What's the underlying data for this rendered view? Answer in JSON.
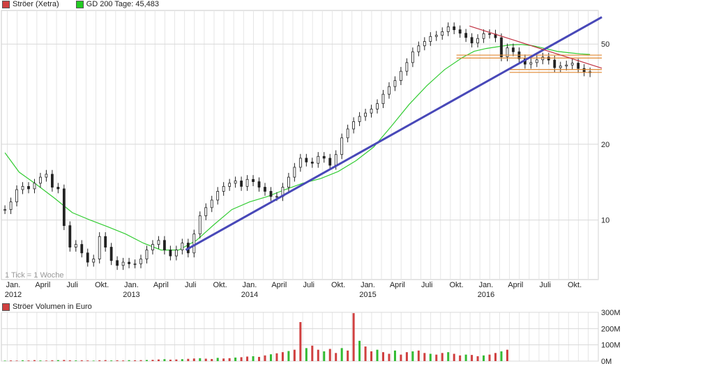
{
  "legend_main": [
    {
      "label": "Ströer (Xetra)",
      "color": "#d04040"
    },
    {
      "label": "GD 200 Tage: 45,483",
      "color": "#22cc22"
    }
  ],
  "legend_volume": {
    "label": "Ströer Volumen in Euro",
    "color": "#d04040"
  },
  "tick_note": "1 Tick = 1 Woche",
  "chart_data": [
    {
      "type": "line",
      "title": "Ströer (Xetra)",
      "yscale": "log",
      "ylim": [
        5.8,
        68
      ],
      "y_ticks": [
        10,
        20,
        50
      ],
      "x_tick_labels": [
        {
          "label": "Jan.",
          "year": "2012",
          "x": 2012.0
        },
        {
          "label": "April",
          "x": 2012.25
        },
        {
          "label": "Juli",
          "x": 2012.5
        },
        {
          "label": "Okt.",
          "x": 2012.75
        },
        {
          "label": "Jan.",
          "year": "2013",
          "x": 2013.0
        },
        {
          "label": "April",
          "x": 2013.25
        },
        {
          "label": "Juli",
          "x": 2013.5
        },
        {
          "label": "Okt.",
          "x": 2013.75
        },
        {
          "label": "Jan.",
          "year": "2014",
          "x": 2014.0
        },
        {
          "label": "April",
          "x": 2014.25
        },
        {
          "label": "Juli",
          "x": 2014.5
        },
        {
          "label": "Okt.",
          "x": 2014.75
        },
        {
          "label": "Jan.",
          "year": "2015",
          "x": 2015.0
        },
        {
          "label": "April",
          "x": 2015.25
        },
        {
          "label": "Juli",
          "x": 2015.5
        },
        {
          "label": "Okt.",
          "x": 2015.75
        },
        {
          "label": "Jan.",
          "year": "2016",
          "x": 2016.0
        },
        {
          "label": "April",
          "x": 2016.25
        },
        {
          "label": "Juli",
          "x": 2016.5
        },
        {
          "label": "Okt.",
          "x": 2016.75
        }
      ],
      "price_series": {
        "name": "Ströer (Xetra)",
        "x": [
          2011.93,
          2011.98,
          2012.03,
          2012.08,
          2012.13,
          2012.18,
          2012.23,
          2012.28,
          2012.33,
          2012.38,
          2012.43,
          2012.48,
          2012.53,
          2012.58,
          2012.63,
          2012.68,
          2012.73,
          2012.78,
          2012.83,
          2012.88,
          2012.93,
          2012.98,
          2013.03,
          2013.08,
          2013.13,
          2013.18,
          2013.23,
          2013.28,
          2013.33,
          2013.38,
          2013.43,
          2013.48,
          2013.53,
          2013.58,
          2013.63,
          2013.68,
          2013.73,
          2013.78,
          2013.83,
          2013.88,
          2013.93,
          2013.98,
          2014.03,
          2014.08,
          2014.13,
          2014.18,
          2014.23,
          2014.28,
          2014.33,
          2014.38,
          2014.43,
          2014.48,
          2014.53,
          2014.58,
          2014.63,
          2014.68,
          2014.73,
          2014.78,
          2014.83,
          2014.88,
          2014.93,
          2014.98,
          2015.03,
          2015.08,
          2015.13,
          2015.18,
          2015.23,
          2015.28,
          2015.33,
          2015.38,
          2015.43,
          2015.48,
          2015.53,
          2015.58,
          2015.63,
          2015.68,
          2015.73,
          2015.78,
          2015.83,
          2015.88,
          2015.93,
          2015.98,
          2016.03,
          2016.08,
          2016.13,
          2016.18,
          2016.23,
          2016.28,
          2016.33,
          2016.38,
          2016.43,
          2016.48,
          2016.53,
          2016.58,
          2016.63,
          2016.68,
          2016.73,
          2016.78,
          2016.83,
          2016.88
        ],
        "y": [
          11.0,
          11.8,
          13.2,
          13.6,
          13.3,
          14.0,
          14.8,
          15.2,
          13.5,
          13.3,
          9.5,
          7.8,
          8.0,
          7.4,
          6.8,
          7.0,
          8.6,
          7.8,
          6.9,
          6.6,
          6.8,
          6.7,
          6.7,
          7.0,
          7.6,
          8.0,
          8.3,
          7.6,
          7.2,
          7.6,
          8.1,
          7.4,
          8.8,
          10.4,
          11.2,
          12.0,
          13.0,
          13.6,
          14.0,
          14.3,
          13.6,
          14.5,
          14.2,
          13.5,
          13.0,
          12.4,
          12.4,
          13.5,
          14.8,
          16.2,
          17.6,
          17.0,
          16.8,
          17.9,
          17.6,
          16.5,
          18.2,
          21.2,
          23.0,
          24.6,
          25.8,
          26.6,
          27.6,
          29.0,
          31.6,
          33.9,
          35.8,
          39.0,
          42.2,
          46.6,
          49.2,
          51.2,
          53.6,
          54.2,
          56.0,
          58.6,
          57.0,
          55.2,
          53.1,
          50.5,
          52.6,
          55.0,
          54.8,
          53.0,
          44.5,
          48.3,
          46.6,
          43.7,
          41.6,
          42.2,
          43.3,
          44.4,
          43.2,
          40.3,
          40.9,
          41.3,
          42.0,
          40.0,
          38.8,
          38.5
        ]
      },
      "gd200_series": {
        "name": "GD 200 Tage",
        "x": [
          2011.93,
          2012.05,
          2012.2,
          2012.35,
          2012.5,
          2012.65,
          2012.8,
          2012.95,
          2013.1,
          2013.25,
          2013.4,
          2013.55,
          2013.7,
          2013.85,
          2014.0,
          2014.15,
          2014.3,
          2014.45,
          2014.6,
          2014.75,
          2014.9,
          2015.05,
          2015.2,
          2015.35,
          2015.5,
          2015.65,
          2015.8,
          2015.9,
          2016.0,
          2016.1,
          2016.2,
          2016.3,
          2016.4,
          2016.5,
          2016.6,
          2016.7,
          2016.8,
          2016.88
        ],
        "y": [
          18.5,
          15.5,
          13.8,
          12.2,
          10.7,
          10.0,
          9.4,
          8.8,
          8.1,
          7.6,
          7.6,
          8.3,
          9.6,
          11.0,
          11.8,
          12.4,
          13.2,
          14.0,
          14.6,
          15.6,
          17.2,
          19.5,
          23.6,
          28.8,
          34.2,
          39.6,
          44.2,
          46.8,
          48.0,
          48.8,
          49.6,
          49.8,
          49.2,
          48.0,
          46.8,
          46.2,
          45.7,
          45.48
        ]
      },
      "trendlines": [
        {
          "name": "support",
          "color": "#4848b8",
          "x": [
            2013.46,
            2016.98
          ],
          "y": [
            7.6,
            64.0
          ]
        },
        {
          "name": "resistance",
          "color": "#c03040",
          "x": [
            2015.86,
            2016.98
          ],
          "y": [
            59.0,
            40.1
          ]
        }
      ],
      "horizontal_lines": [
        {
          "color": "#e08830",
          "x": [
            2015.75,
            2016.98
          ],
          "y": 45.2
        },
        {
          "color": "#e08830",
          "x": [
            2015.75,
            2016.98
          ],
          "y": 44.0
        },
        {
          "color": "#e08830",
          "x": [
            2016.2,
            2016.98
          ],
          "y": 39.6
        },
        {
          "color": "#e08830",
          "x": [
            2016.2,
            2016.98
          ],
          "y": 38.6
        }
      ],
      "grid": true,
      "legend_placement": "top-left"
    },
    {
      "type": "bar",
      "title": "Ströer Volumen in Euro",
      "ylim": [
        0,
        300
      ],
      "y_ticks": [
        {
          "value": 0,
          "label": "0M"
        },
        {
          "value": 100,
          "label": "100M"
        },
        {
          "value": 200,
          "label": "200M"
        },
        {
          "value": 300,
          "label": "300M"
        }
      ],
      "unit": "M",
      "x_start": 2011.93,
      "x_step": 0.05,
      "values": [
        3,
        4,
        3,
        5,
        4,
        6,
        4,
        3,
        5,
        6,
        7,
        5,
        4,
        5,
        4,
        3,
        5,
        6,
        4,
        5,
        4,
        6,
        5,
        6,
        7,
        8,
        10,
        12,
        9,
        10,
        12,
        14,
        16,
        18,
        15,
        13,
        20,
        16,
        18,
        22,
        24,
        28,
        30,
        26,
        35,
        42,
        48,
        55,
        62,
        70,
        240,
        80,
        95,
        70,
        60,
        75,
        50,
        80,
        65,
        295,
        125,
        90,
        60,
        70,
        55,
        45,
        65,
        40,
        55,
        60,
        65,
        50,
        45,
        40,
        50,
        55,
        45,
        35,
        40,
        38,
        30,
        35,
        40,
        50,
        60,
        70
      ],
      "series_color": "#d04040",
      "alt_color": "#33bb33",
      "grid": true
    }
  ]
}
